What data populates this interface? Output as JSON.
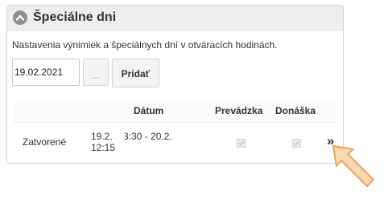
{
  "panel": {
    "title": "Špeciálne dni",
    "description": "Nastavenia výnimiek a špeciálnych dní v otváracích hodinách."
  },
  "form": {
    "date_value": "19.02.2021",
    "picker_label": "...",
    "add_label": "Pridať"
  },
  "table": {
    "headers": {
      "date": "Dátum",
      "operation": "Prevádzka",
      "delivery": "Donáška"
    },
    "rows": [
      {
        "status": "Zatvorené",
        "range_start": "19.2. 12:15",
        "range_end": "8:30 - 20.2.",
        "operation_checked": true,
        "delivery_checked": true,
        "detail_label": "»"
      }
    ]
  },
  "colors": {
    "header_bg": "#eeeeee",
    "arrow_fill": "#fcd9b4",
    "arrow_stroke": "#e6a463"
  }
}
